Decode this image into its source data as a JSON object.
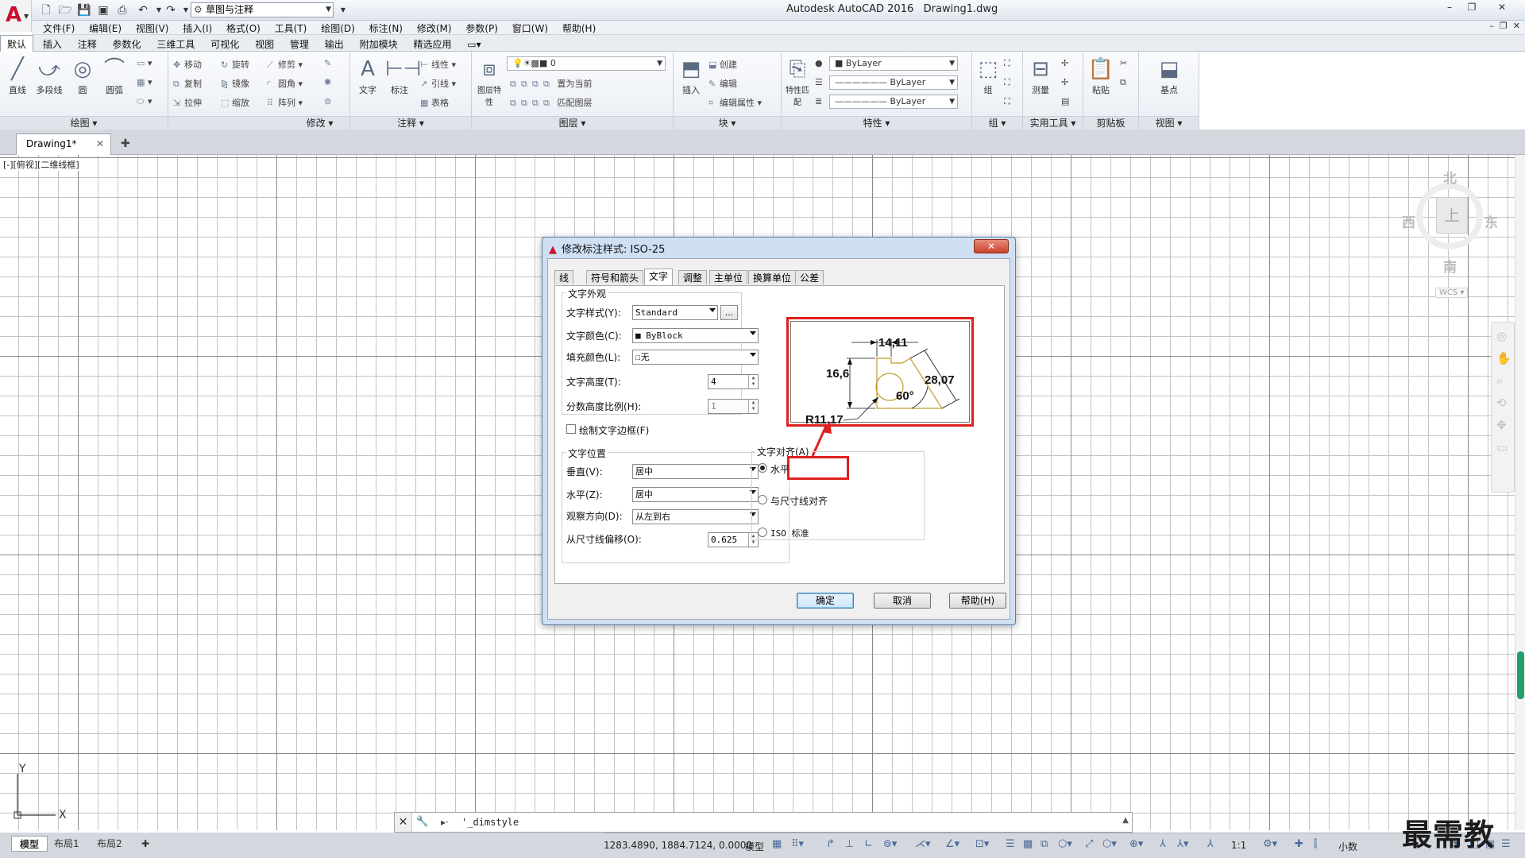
{
  "app": {
    "title": "Autodesk AutoCAD 2016",
    "file": "Drawing1.dwg",
    "workspace": "草图与注释",
    "logo_letter": "A"
  },
  "menubar": [
    "文件(F)",
    "编辑(E)",
    "视图(V)",
    "插入(I)",
    "格式(O)",
    "工具(T)",
    "绘图(D)",
    "标注(N)",
    "修改(M)",
    "参数(P)",
    "窗口(W)",
    "帮助(H)"
  ],
  "ribbon_tabs": [
    "默认",
    "插入",
    "注释",
    "参数化",
    "三维工具",
    "可视化",
    "视图",
    "管理",
    "输出",
    "附加模块",
    "精选应用"
  ],
  "ribbon": {
    "draw": {
      "title": "绘图",
      "tools": [
        "直线",
        "多段线",
        "圆",
        "圆弧"
      ]
    },
    "modify": {
      "title": "修改",
      "tools": [
        "移动",
        "旋转",
        "修剪",
        "复制",
        "镜像",
        "圆角",
        "拉伸",
        "缩放",
        "阵列"
      ]
    },
    "annotation": {
      "title": "注释",
      "tools": [
        "文字",
        "标注",
        "线性",
        "引线",
        "表格"
      ]
    },
    "layers": {
      "title": "图层",
      "tools": [
        "图层特性",
        "置为当前",
        "匹配图层"
      ],
      "current_layer": "0"
    },
    "block": {
      "title": "块",
      "tools": [
        "插入",
        "创建",
        "编辑",
        "编辑属性"
      ]
    },
    "properties": {
      "title": "特性",
      "tools": [
        "特性匹配"
      ],
      "color": "ByLayer",
      "linetype": "ByLayer",
      "lineweight": "ByLayer"
    },
    "groups": {
      "title": "组",
      "tools": [
        "组"
      ]
    },
    "utilities": {
      "title": "实用工具",
      "tools": [
        "测量"
      ]
    },
    "clipboard": {
      "title": "剪贴板",
      "tools": [
        "粘贴"
      ]
    },
    "view": {
      "title": "视图",
      "tools": [
        "基点"
      ]
    }
  },
  "file_tab": "Drawing1*",
  "viewport_label": "[-][俯视][二维线框]",
  "viewcube": {
    "north": "北",
    "south": "南",
    "east": "东",
    "west": "西",
    "wcs": "WCS"
  },
  "ucs": {
    "x": "X",
    "y": "Y"
  },
  "command": {
    "prompt": "▸·",
    "text": "'_dimstyle"
  },
  "layout_tabs": [
    "模型",
    "布局1",
    "布局2"
  ],
  "status": {
    "coords": "1283.4890, 1884.7124, 0.0000",
    "model": "模型",
    "scale": "1:1",
    "units": "小数"
  },
  "watermark": "最需教育",
  "dialog": {
    "title": "修改标注样式: ISO-25",
    "close": "✕",
    "tabs": [
      "线",
      "符号和箭头",
      "文字",
      "调整",
      "主单位",
      "换算单位",
      "公差"
    ],
    "active_tab": "文字",
    "appearance": {
      "title": "文字外观",
      "text_style_label": "文字样式(Y):",
      "text_style": "Standard",
      "browse": "...",
      "text_color_label": "文字颜色(C):",
      "text_color": "ByBlock",
      "fill_color_label": "填充颜色(L):",
      "fill_color": "无",
      "text_height_label": "文字高度(T):",
      "text_height": "4",
      "fraction_scale_label": "分数高度比例(H):",
      "fraction_scale": "1",
      "draw_frame_label": "绘制文字边框(F)"
    },
    "placement": {
      "title": "文字位置",
      "vertical_label": "垂直(V):",
      "vertical": "居中",
      "horizontal_label": "水平(Z):",
      "horizontal": "居中",
      "view_direction_label": "观察方向(D):",
      "view_direction": "从左到右",
      "offset_label": "从尺寸线偏移(O):",
      "offset": "0.625"
    },
    "alignment": {
      "title": "文字对齐(A)",
      "options": [
        "水平",
        "与尺寸线对齐",
        "ISO 标准"
      ],
      "selected": "水平"
    },
    "preview": {
      "d1": "14,11",
      "d2": "16,6",
      "d3": "28,07",
      "angle": "60°",
      "radius": "R11,17"
    },
    "buttons": {
      "ok": "确定",
      "cancel": "取消",
      "help": "帮助(H)"
    }
  },
  "colors": {
    "highlight": "#e02020",
    "grid_major": "#8a8a8a",
    "grid_minor": "#c4c4c4",
    "autocad_red": "#c8102e",
    "preview_shape": "#c59a2a"
  }
}
